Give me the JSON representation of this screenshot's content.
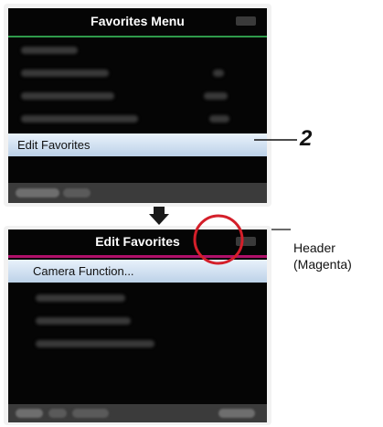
{
  "favorites_menu": {
    "title": "Favorites Menu",
    "selected_item": "Edit Favorites",
    "step_number": "2"
  },
  "edit_favorites": {
    "title": "Edit Favorites",
    "selected_item": "Camera Function..."
  },
  "callout": {
    "line1": "Header",
    "line2": "(Magenta)"
  },
  "colors": {
    "header_rule_top": "#2f9a4a",
    "header_rule_bottom": "#b0106a",
    "highlight_circle": "#d41f2a",
    "selection": "#cfe0f2"
  }
}
